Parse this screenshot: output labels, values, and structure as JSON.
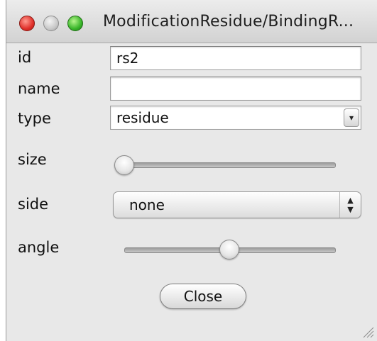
{
  "window": {
    "title": "ModificationResidue/BindingR..."
  },
  "form": {
    "id_label": "id",
    "id_value": "rs2",
    "name_label": "name",
    "name_value": "",
    "type_label": "type",
    "type_value": "residue",
    "size_label": "size",
    "size_level": 0.0,
    "side_label": "side",
    "side_value": "none",
    "angle_label": "angle",
    "angle_level": 0.5
  },
  "buttons": {
    "close_label": "Close"
  },
  "colors": {
    "close_light": "#e0302a",
    "minimize_light": "#c9c9c9",
    "zoom_light": "#39b52a",
    "window_bg": "#e8e8e8"
  }
}
